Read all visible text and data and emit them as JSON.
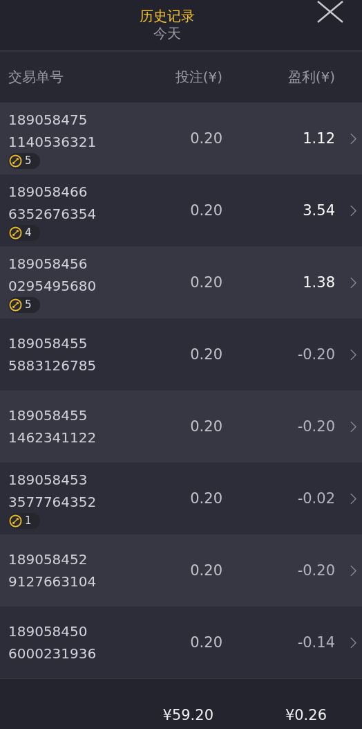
{
  "header": {
    "title": "历史记录",
    "subtitle": "今天"
  },
  "columns": [
    "交易单号",
    "投注(¥)",
    "盈利(¥)"
  ],
  "rows": [
    {
      "id_lines": [
        "189058475",
        "1140536321"
      ],
      "badge": "5",
      "bet": "0.20",
      "profit": "1.12",
      "kind": "win"
    },
    {
      "id_lines": [
        "189058466",
        "6352676354"
      ],
      "badge": "4",
      "bet": "0.20",
      "profit": "3.54",
      "kind": "win"
    },
    {
      "id_lines": [
        "189058456",
        "0295495680"
      ],
      "badge": "5",
      "bet": "0.20",
      "profit": "1.38",
      "kind": "win"
    },
    {
      "id_lines": [
        "189058455",
        "5883126785"
      ],
      "bet": "0.20",
      "profit": "-0.20",
      "kind": "loss"
    },
    {
      "id_lines": [
        "189058455",
        "1462341122"
      ],
      "bet": "0.20",
      "profit": "-0.20",
      "kind": "loss"
    },
    {
      "id_lines": [
        "189058453",
        "3577764352"
      ],
      "badge": "1",
      "bet": "0.20",
      "profit": "-0.02",
      "kind": "loss"
    },
    {
      "id_lines": [
        "189058452",
        "9127663104"
      ],
      "bet": "0.20",
      "profit": "-0.20",
      "kind": "loss"
    },
    {
      "id_lines": [
        "189058450",
        "6000231936"
      ],
      "bet": "0.20",
      "profit": "-0.14",
      "kind": "loss"
    }
  ],
  "footer": {
    "total_bet": "¥59.20",
    "total_profit": "¥0.26"
  }
}
